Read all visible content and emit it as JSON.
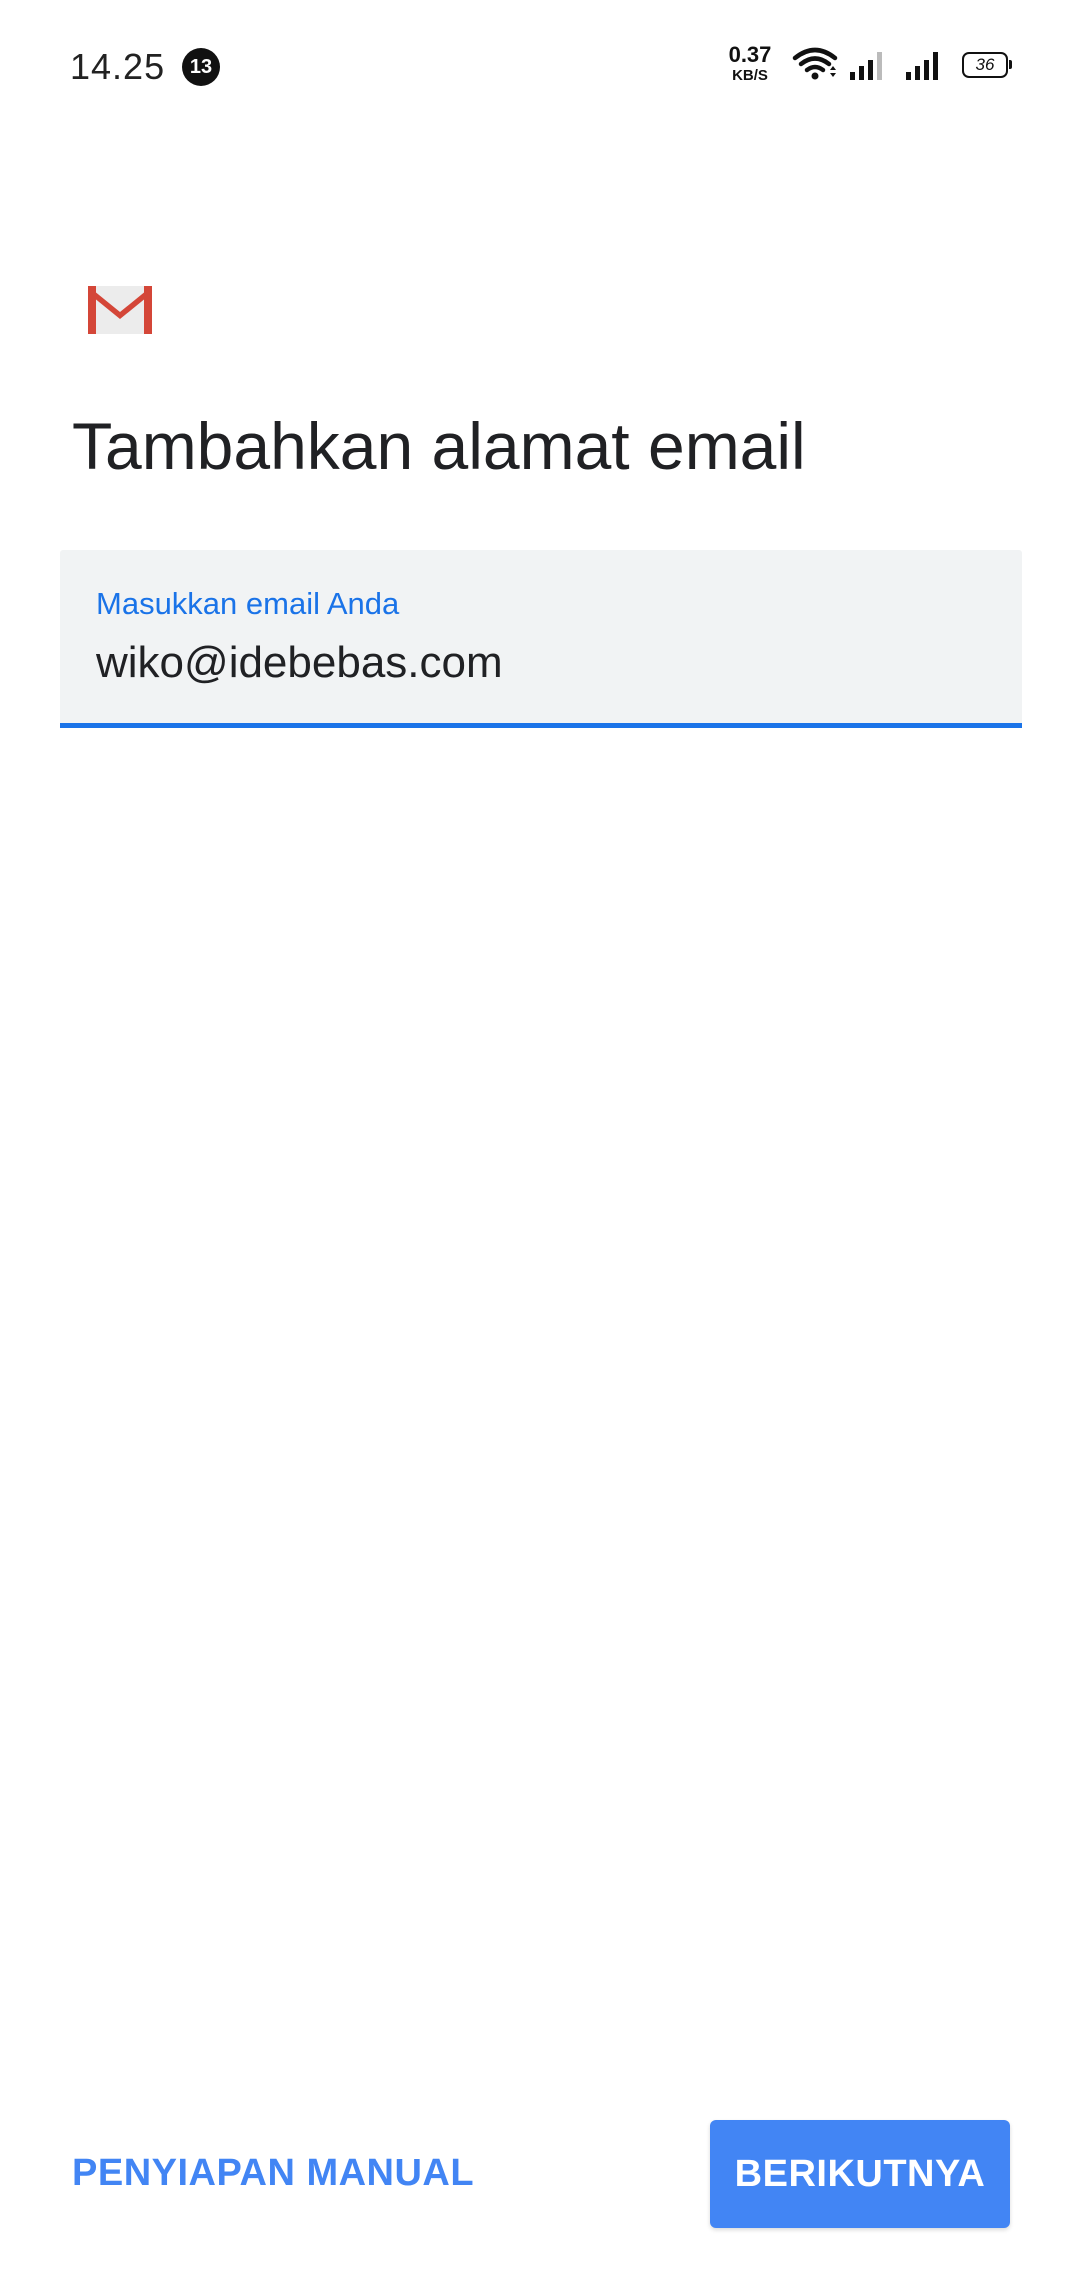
{
  "status_bar": {
    "time": "14.25",
    "notification_count": "13",
    "net_speed_value": "0.37",
    "net_speed_unit": "KB/S",
    "battery_level": "36",
    "icons": [
      "wifi-icon",
      "signal-icon",
      "signal-icon",
      "battery-icon"
    ]
  },
  "header": {
    "logo": "gmail-logo",
    "title": "Tambahkan alamat email"
  },
  "email_field": {
    "label": "Masukkan email Anda",
    "value": "wiko@idebebas.com"
  },
  "actions": {
    "manual_setup_label": "PENYIAPAN MANUAL",
    "next_label": "BERIKUTNYA"
  },
  "colors": {
    "accent": "#1a73e8",
    "button": "#4285f4",
    "field_background": "#f1f3f4",
    "gmail_red": "#d44638"
  }
}
